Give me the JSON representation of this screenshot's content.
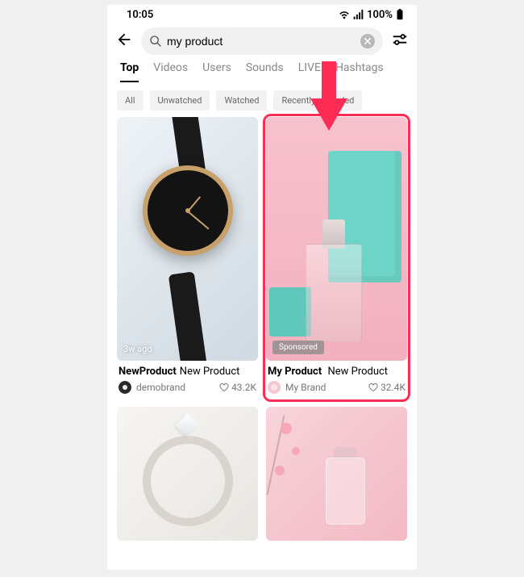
{
  "status": {
    "time": "10:05",
    "battery_pct": "100%"
  },
  "search": {
    "query": "my product"
  },
  "tabs": {
    "items": [
      "Top",
      "Videos",
      "Users",
      "Sounds",
      "LIVE",
      "Hashtags"
    ],
    "active_index": 0
  },
  "chips": {
    "items": [
      "All",
      "Unwatched",
      "Watched",
      "Recently uploaded"
    ]
  },
  "results": [
    {
      "title_bold": "NewProduct",
      "title_rest": "New Product",
      "brand": "demobrand",
      "likes": "43.2K",
      "time_badge": "3w ago",
      "sponsored": false
    },
    {
      "title_bold": "My Product",
      "title_rest": "New Product",
      "brand": "My Brand",
      "likes": "32.4K",
      "time_badge": "",
      "sponsored": true,
      "sponsored_label": "Sponsored"
    }
  ]
}
